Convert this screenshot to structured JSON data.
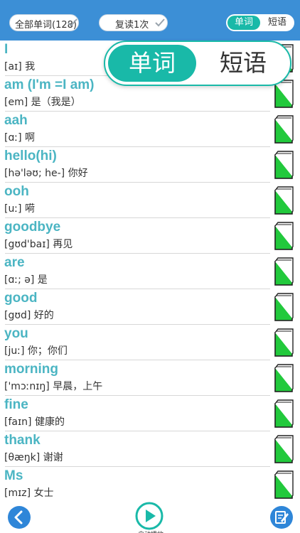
{
  "header": {
    "filter_label": "全部单词(128)",
    "review_label": "复读1次",
    "toggle": {
      "words": "单词",
      "phrases": "短语"
    }
  },
  "popup": {
    "words": "单词",
    "phrases": "短语"
  },
  "colors": {
    "topbar": "#3c8fd6",
    "accent": "#19b9a8",
    "word": "#4bb5c3",
    "book_fill": "#22c93c"
  },
  "words": [
    {
      "word": "I",
      "pron": "[aɪ]  我"
    },
    {
      "word": "am (I'm =I am)",
      "pron": "[em]  是（我是）"
    },
    {
      "word": "aah",
      "pron": "[ɑː]  啊"
    },
    {
      "word": "hello(hi)",
      "pron": "[hə'ləʊ; he-]  你好"
    },
    {
      "word": "ooh",
      "pron": "[uː]  嗬"
    },
    {
      "word": "goodbye",
      "pron": "[gʊd'baɪ]  再见"
    },
    {
      "word": "are",
      "pron": "[ɑː; ə]  是"
    },
    {
      "word": "good",
      "pron": "[gʊd]  好的"
    },
    {
      "word": "you",
      "pron": "[juː]  你；你们"
    },
    {
      "word": "morning",
      "pron": "['mɔːnɪŋ]  早晨，上午"
    },
    {
      "word": "fine",
      "pron": "[faɪn]  健康的"
    },
    {
      "word": "thank",
      "pron": "[θæŋk]  谢谢"
    },
    {
      "word": "Ms",
      "pron": "[mɪz]  女士"
    }
  ],
  "footer": {
    "back_icon": "chevron-left-icon",
    "play_icon": "play-icon",
    "play_label": "自动播放",
    "edit_icon": "edit-icon"
  }
}
